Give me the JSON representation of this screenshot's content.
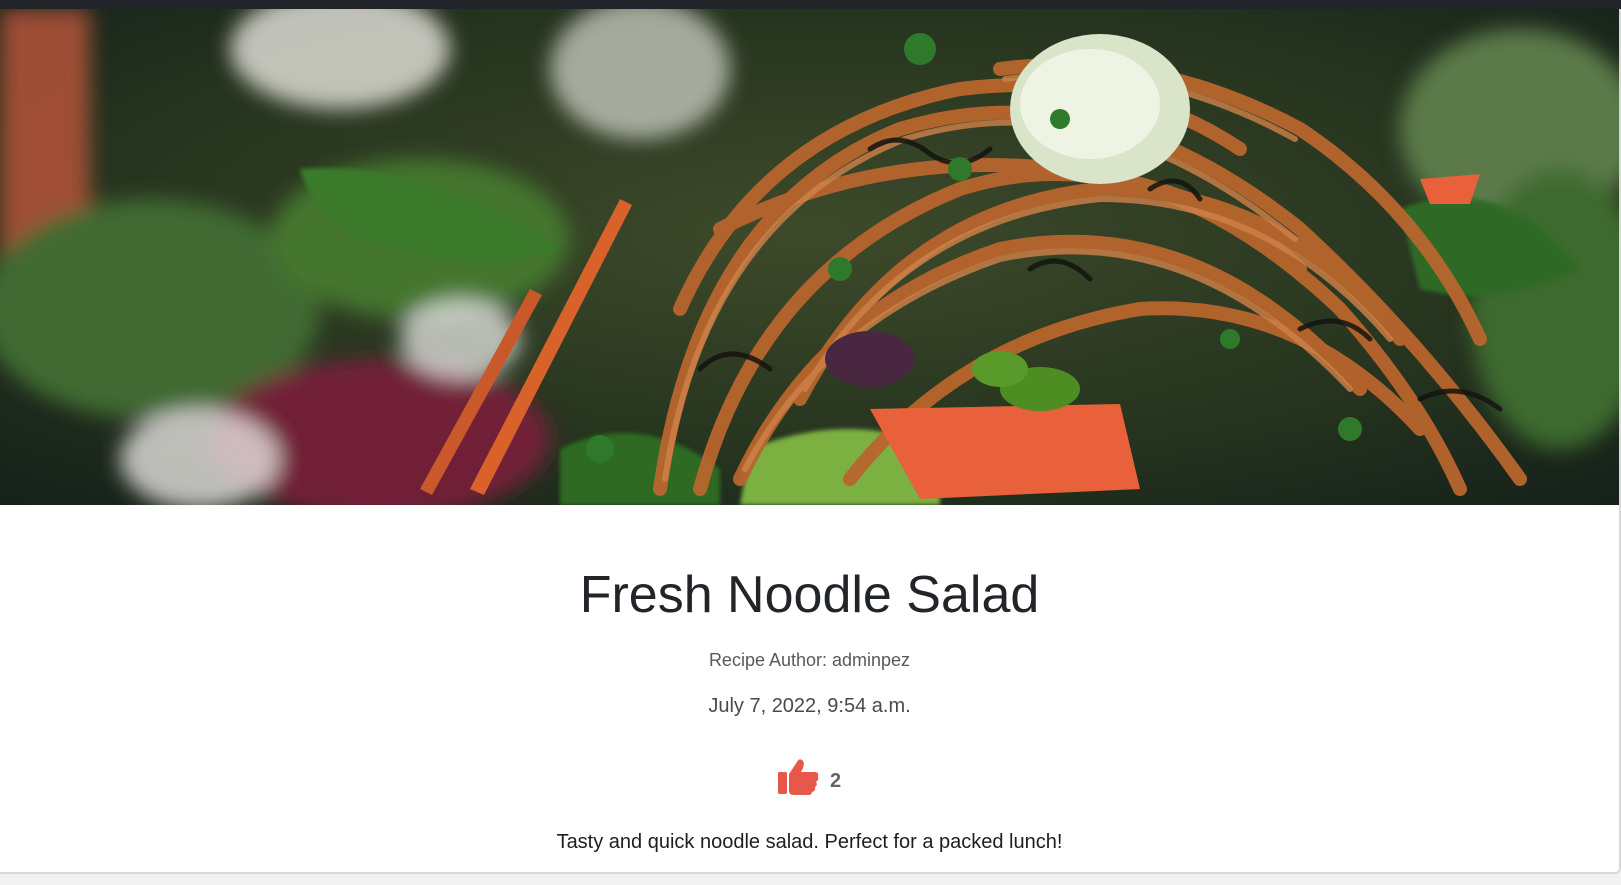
{
  "recipe": {
    "title": "Fresh Noodle Salad",
    "author": "Recipe Author: adminpez",
    "date": "July 7, 2022, 9:54 a.m.",
    "likes": "2",
    "description": "Tasty and quick noodle salad. Perfect for a packed lunch!",
    "like_icon": "thumbs-up-icon",
    "image": "noodle-salad-photo"
  },
  "colors": {
    "topbar": "#212529",
    "like_icon": "#e8584a",
    "title": "#212529",
    "muted": "#595959"
  }
}
